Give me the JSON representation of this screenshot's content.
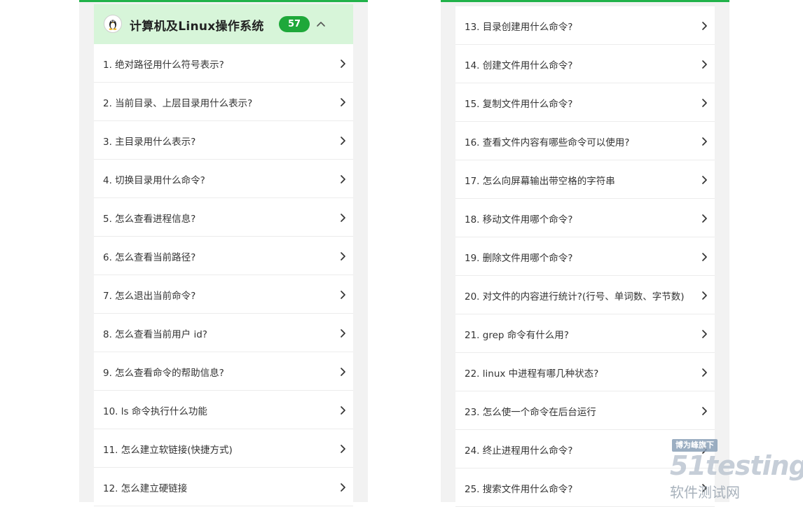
{
  "category": {
    "title": "计算机及Linux操作系统",
    "count": "57",
    "icon": "linux-tux-icon",
    "expanded": true
  },
  "accent_color": "#1ea83a",
  "left_items": [
    "1. 绝对路径用什么符号表示?",
    "2. 当前目录、上层目录用什么表示?",
    "3. 主目录用什么表示?",
    "4. 切换目录用什么命令?",
    "5. 怎么查看进程信息?",
    "6. 怎么查看当前路径?",
    "7. 怎么退出当前命令?",
    "8. 怎么查看当前用户 id?",
    "9. 怎么查看命令的帮助信息?",
    "10. ls 命令执行什么功能",
    "11. 怎么建立软链接(快捷方式)",
    "12. 怎么建立硬链接"
  ],
  "right_items": [
    "13. 目录创建用什么命令?",
    "14. 创建文件用什么命令?",
    "15. 复制文件用什么命令?",
    "16. 查看文件内容有哪些命令可以使用?",
    "17. 怎么向屏幕输出带空格的字符串",
    "18. 移动文件用哪个命令?",
    "19. 删除文件用哪个命令?",
    "20. 对文件的内容进行统计?(行号、单词数、字节数)",
    "21. grep 命令有什么用?",
    "22. linux 中进程有哪几种状态?",
    "23. 怎么使一个命令在后台运行",
    "24. 终止进程用什么命令?",
    "25. 搜索文件用什么命令?"
  ],
  "watermark": {
    "tag": "博为峰旗下",
    "logo": "51testing",
    "subtitle": "软件测试网"
  }
}
